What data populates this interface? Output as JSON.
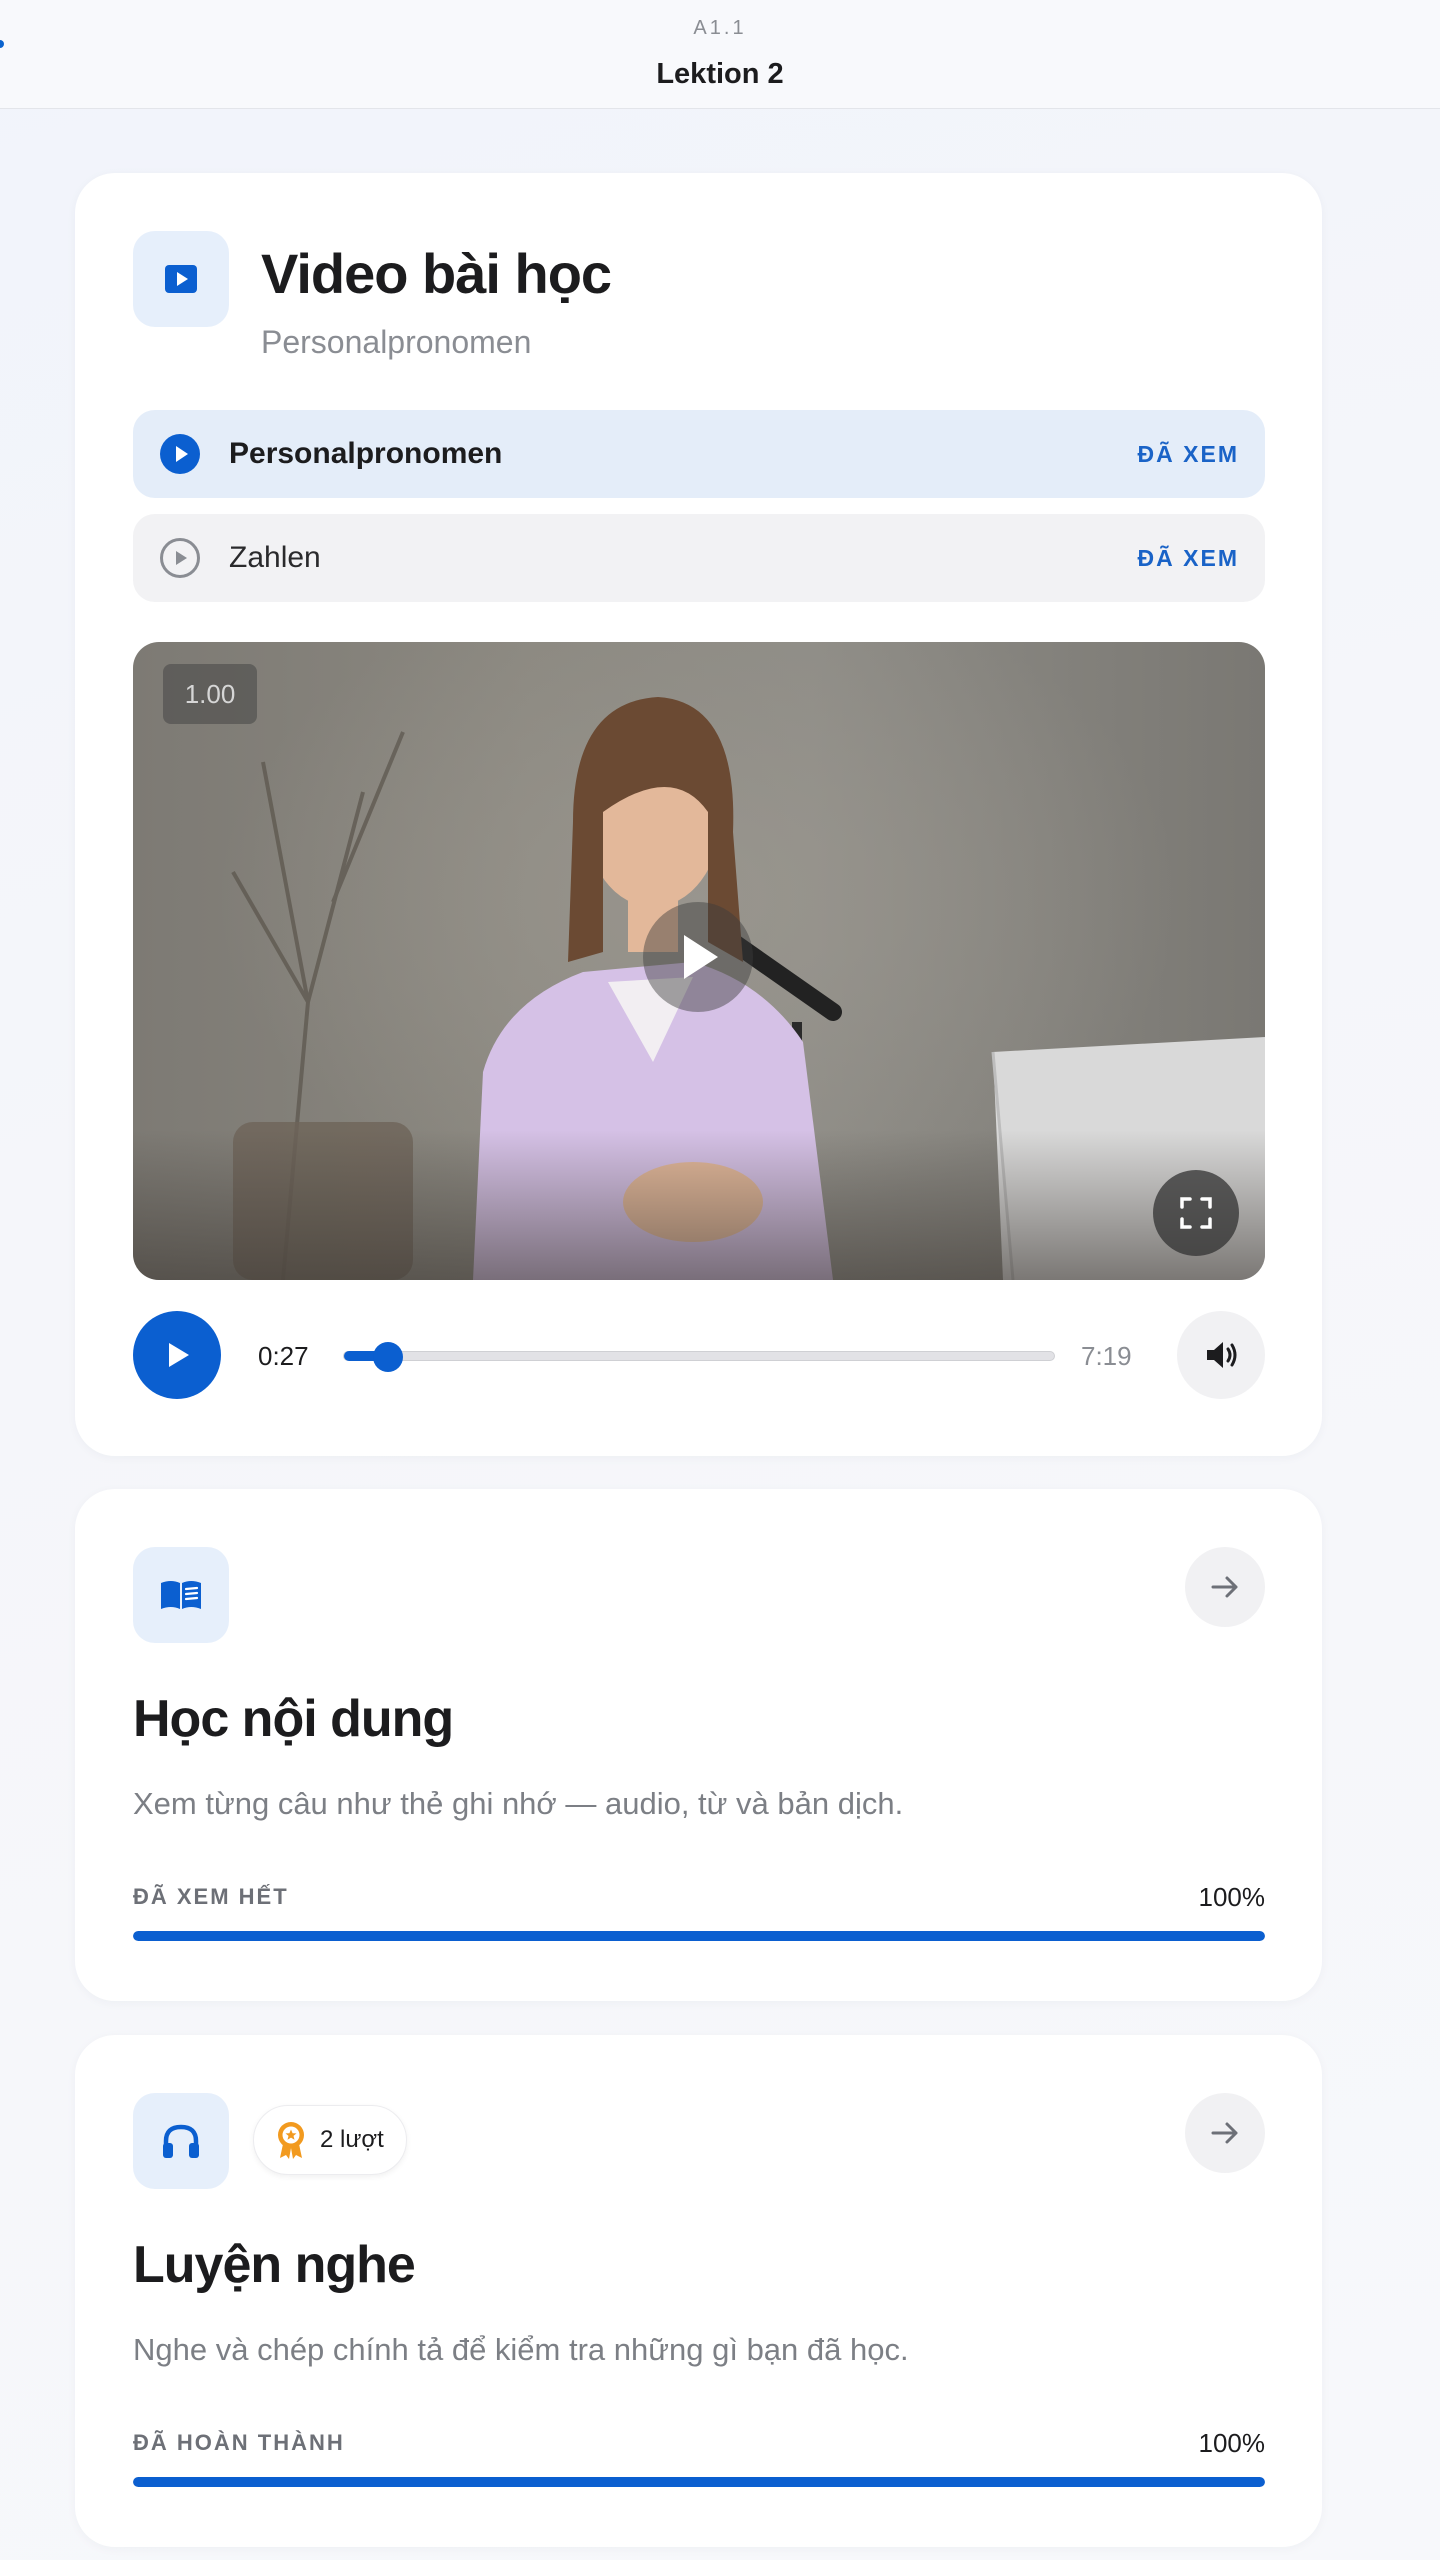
{
  "header": {
    "level": "A1.1",
    "title": "Lektion 2"
  },
  "video_card": {
    "title": "Video bài học",
    "subtitle": "Personalpronomen",
    "lessons": [
      {
        "name": "Personalpronomen",
        "status": "ĐÃ XEM",
        "active": true
      },
      {
        "name": "Zahlen",
        "status": "ĐÃ XEM",
        "active": false
      }
    ],
    "player": {
      "speed": "1.00",
      "current_time": "0:27",
      "total_time": "7:19",
      "progress_fraction": 0.062
    }
  },
  "learn_card": {
    "title": "Học nội dung",
    "description": "Xem từng câu như thẻ ghi nhớ — audio, từ và bản dịch.",
    "progress_label": "ĐÃ XEM HẾT",
    "progress_percent": "100%",
    "progress_value": 1.0
  },
  "listen_card": {
    "badge": "2 lượt",
    "title": "Luyện nghe",
    "description": "Nghe và chép chính tả để kiểm tra những gì bạn đã học.",
    "progress_label": "ĐÃ HOÀN THÀNH",
    "progress_percent": "100%",
    "progress_value": 1.0
  },
  "colors": {
    "accent": "#0b5fd0",
    "tile_bg": "#e6effb",
    "badge_orange": "#f29a1f"
  }
}
